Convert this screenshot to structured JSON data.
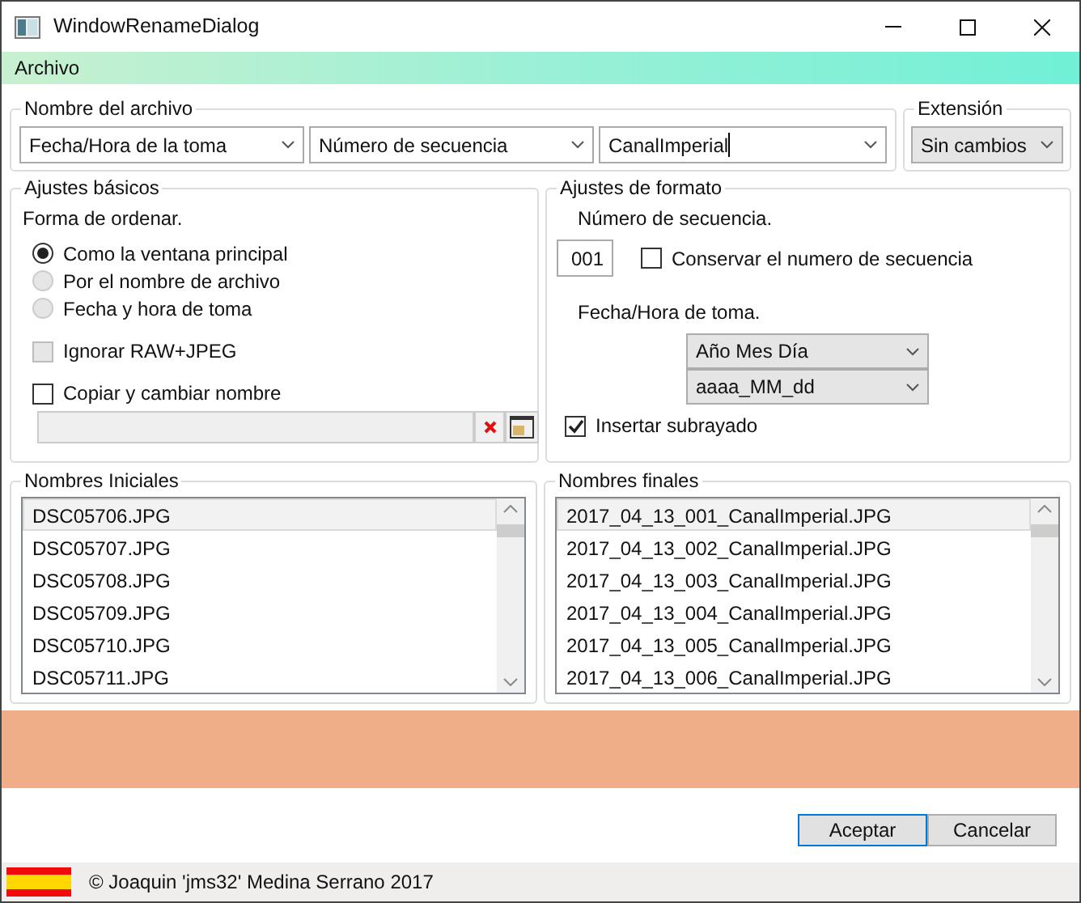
{
  "window": {
    "title": "WindowRenameDialog"
  },
  "menu": [
    "Archivo"
  ],
  "filename": {
    "legend": "Nombre del archivo",
    "parts": [
      {
        "value": "Fecha/Hora de la toma",
        "kind": "dropdown"
      },
      {
        "value": "Número de secuencia",
        "kind": "dropdown"
      },
      {
        "value": "CanalImperial",
        "kind": "editable"
      }
    ]
  },
  "extension": {
    "legend": "Extensión",
    "value": "Sin cambios"
  },
  "basic": {
    "legend": "Ajustes básicos",
    "sort_label": "Forma de ordenar.",
    "options": [
      {
        "label": "Como la ventana principal",
        "selected": true,
        "disabled": false
      },
      {
        "label": "Por el nombre de archivo",
        "selected": false,
        "disabled": true
      },
      {
        "label": "Fecha y hora de toma",
        "selected": false,
        "disabled": true
      }
    ],
    "ignore": {
      "label": "Ignorar RAW+JPEG",
      "checked": false,
      "disabled": true
    },
    "copy": {
      "label": "Copiar y cambiar nombre",
      "checked": false
    }
  },
  "format": {
    "legend": "Ajustes de formato",
    "seq_label": "Número de secuencia.",
    "seq_value": "001",
    "keep": {
      "label": "Conservar el numero de secuencia",
      "checked": false
    },
    "date_label": "Fecha/Hora de toma.",
    "date_order": "Año Mes Día",
    "date_format": "aaaa_MM_dd",
    "underscore": {
      "label": "Insertar subrayado",
      "checked": true
    }
  },
  "initial": {
    "legend": "Nombres Iniciales",
    "items": [
      {
        "name": "DSC05706.JPG",
        "selected": true
      },
      {
        "name": "DSC05707.JPG",
        "selected": false
      },
      {
        "name": "DSC05708.JPG",
        "selected": false
      },
      {
        "name": "DSC05709.JPG",
        "selected": false
      },
      {
        "name": "DSC05710.JPG",
        "selected": false
      },
      {
        "name": "DSC05711.JPG",
        "selected": false
      }
    ]
  },
  "final": {
    "legend": "Nombres finales",
    "items": [
      {
        "name": "2017_04_13_001_CanalImperial.JPG",
        "selected": true
      },
      {
        "name": "2017_04_13_002_CanalImperial.JPG",
        "selected": false
      },
      {
        "name": "2017_04_13_003_CanalImperial.JPG",
        "selected": false
      },
      {
        "name": "2017_04_13_004_CanalImperial.JPG",
        "selected": false
      },
      {
        "name": "2017_04_13_005_CanalImperial.JPG",
        "selected": false
      },
      {
        "name": "2017_04_13_006_CanalImperial.JPG",
        "selected": false
      }
    ]
  },
  "buttons": [
    "Aceptar",
    "Cancelar"
  ],
  "status_bar": {
    "text": "© Joaquin 'jms32' Medina Serrano 2017"
  }
}
